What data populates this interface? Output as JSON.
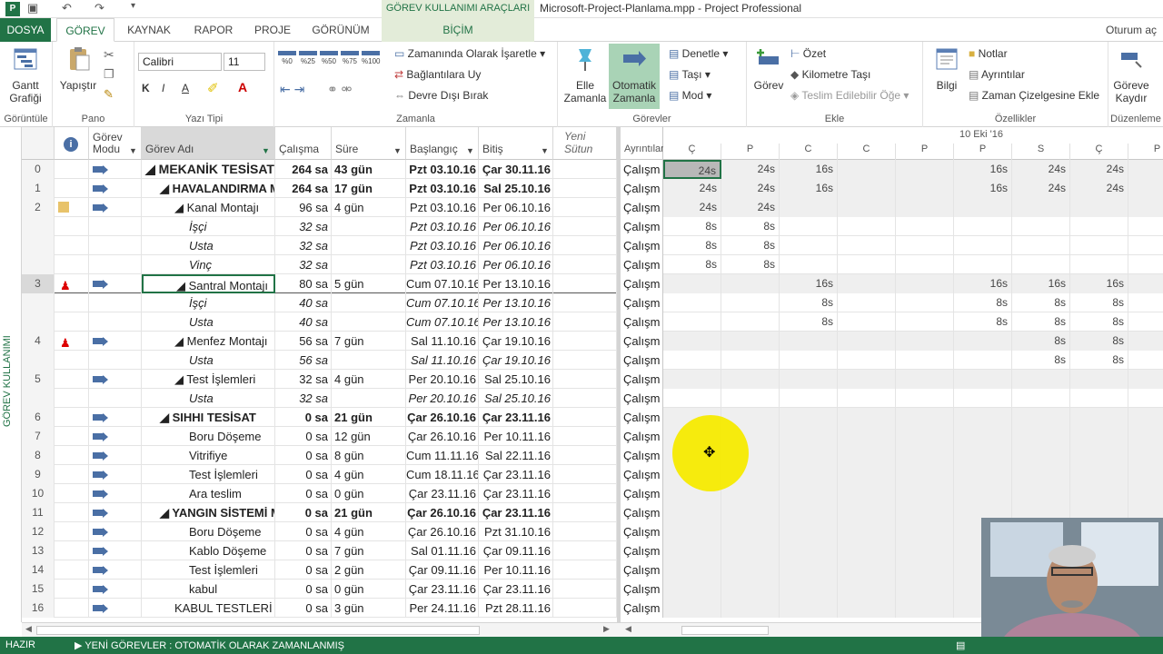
{
  "titlebar": {
    "app_icon": "P",
    "tool_tab": "GÖREV KULLANIMI ARAÇLARI",
    "title": "Microsoft-Project-Planlama.mpp - Project Professional",
    "icons": [
      "save-icon",
      "undo-icon",
      "redo-icon",
      "customize-icon"
    ]
  },
  "tabs": {
    "file": "DOSYA",
    "items": [
      "GÖREV",
      "KAYNAK",
      "RAPOR",
      "PROJE",
      "GÖRÜNÜM"
    ],
    "tool_tab": "BİÇİM",
    "signin": "Oturum aç"
  },
  "ribbon": {
    "view": {
      "gantt": "Gantt\nGrafiği",
      "label": "Görüntüle"
    },
    "clipboard": {
      "paste": "Yapıştır",
      "label": "Pano"
    },
    "font": {
      "name": "Calibri",
      "size": "11",
      "label": "Yazı Tipi"
    },
    "schedule": {
      "percent_buttons": [
        "%0",
        "%25",
        "%50",
        "%75",
        "%100"
      ],
      "mark_on_track": "Zamanında Olarak İşaretle",
      "respect_links": "Bağlantılara Uy",
      "inactivate": "Devre Dışı Bırak",
      "label": "Zamanla"
    },
    "tasks": {
      "manual": "Elle\nZamanla",
      "auto": "Otomatik\nZamanla",
      "inspect": "Denetle",
      "move": "Taşı",
      "mode": "Mod",
      "label": "Görevler"
    },
    "insert": {
      "task": "Görev",
      "summary": "Özet",
      "milestone": "Kilometre Taşı",
      "deliverable": "Teslim Edilebilir Öğe",
      "label": "Ekle"
    },
    "properties": {
      "info": "Bilgi",
      "notes": "Notlar",
      "details": "Ayrıntılar",
      "add_timeline": "Zaman Çizelgesine Ekle",
      "label": "Özellikler"
    },
    "editing": {
      "scroll": "Göreve\nKaydır",
      "label": "Düzenleme"
    }
  },
  "side_label": "GÖREV KULLANIMI",
  "grid": {
    "headers": {
      "mode": "Görev\nModu",
      "name": "Görev Adı",
      "work": "Çalışma",
      "duration": "Süre",
      "start": "Başlangıç",
      "finish": "Bitiş",
      "new_col": "Yeni Sütun"
    },
    "rows": [
      {
        "id": "0",
        "ind": "",
        "mode": true,
        "indent": 0,
        "name": "◢ MEKANİK TESİSAT",
        "work": "264 sa",
        "dur": "43 gün",
        "start": "Pzt 03.10.16",
        "fin": "Çar 30.11.16",
        "bold": true,
        "ital": false,
        "big": true
      },
      {
        "id": "1",
        "ind": "",
        "mode": true,
        "indent": 1,
        "name": "◢ HAVALANDIRMA MONTAJI",
        "work": "264 sa",
        "dur": "17 gün",
        "start": "Pzt 03.10.16",
        "fin": "Sal 25.10.16",
        "bold": true,
        "ital": false
      },
      {
        "id": "2",
        "ind": "note",
        "mode": true,
        "indent": 2,
        "name": "◢ Kanal Montajı",
        "work": "96 sa",
        "dur": "4 gün",
        "start": "Pzt 03.10.16",
        "fin": "Per 06.10.16",
        "bold": false,
        "ital": false
      },
      {
        "id": "",
        "ind": "",
        "mode": false,
        "indent": 3,
        "name": "İşçi",
        "work": "32 sa",
        "dur": "",
        "start": "Pzt 03.10.16",
        "fin": "Per 06.10.16",
        "bold": false,
        "ital": true
      },
      {
        "id": "",
        "ind": "",
        "mode": false,
        "indent": 3,
        "name": "Usta",
        "work": "32 sa",
        "dur": "",
        "start": "Pzt 03.10.16",
        "fin": "Per 06.10.16",
        "bold": false,
        "ital": true
      },
      {
        "id": "",
        "ind": "",
        "mode": false,
        "indent": 3,
        "name": "Vinç",
        "work": "32 sa",
        "dur": "",
        "start": "Pzt 03.10.16",
        "fin": "Per 06.10.16",
        "bold": false,
        "ital": true
      },
      {
        "id": "3",
        "ind": "person",
        "mode": true,
        "indent": 2,
        "name": "◢ Santral Montajı",
        "work": "80 sa",
        "dur": "5 gün",
        "start": "Cum 07.10.16",
        "fin": "Per 13.10.16",
        "bold": false,
        "ital": false,
        "selected": true
      },
      {
        "id": "",
        "ind": "",
        "mode": false,
        "indent": 3,
        "name": "İşçi",
        "work": "40 sa",
        "dur": "",
        "start": "Cum 07.10.16",
        "fin": "Per 13.10.16",
        "bold": false,
        "ital": true
      },
      {
        "id": "",
        "ind": "",
        "mode": false,
        "indent": 3,
        "name": "Usta",
        "work": "40 sa",
        "dur": "",
        "start": "Cum 07.10.16",
        "fin": "Per 13.10.16",
        "bold": false,
        "ital": true
      },
      {
        "id": "4",
        "ind": "person",
        "mode": true,
        "indent": 2,
        "name": "◢ Menfez Montajı",
        "work": "56 sa",
        "dur": "7 gün",
        "start": "Sal 11.10.16",
        "fin": "Çar 19.10.16",
        "bold": false,
        "ital": false
      },
      {
        "id": "",
        "ind": "",
        "mode": false,
        "indent": 3,
        "name": "Usta",
        "work": "56 sa",
        "dur": "",
        "start": "Sal 11.10.16",
        "fin": "Çar 19.10.16",
        "bold": false,
        "ital": true
      },
      {
        "id": "5",
        "ind": "",
        "mode": true,
        "indent": 2,
        "name": "◢ Test İşlemleri",
        "work": "32 sa",
        "dur": "4 gün",
        "start": "Per 20.10.16",
        "fin": "Sal 25.10.16",
        "bold": false,
        "ital": false
      },
      {
        "id": "",
        "ind": "",
        "mode": false,
        "indent": 3,
        "name": "Usta",
        "work": "32 sa",
        "dur": "",
        "start": "Per 20.10.16",
        "fin": "Sal 25.10.16",
        "bold": false,
        "ital": true
      },
      {
        "id": "6",
        "ind": "",
        "mode": true,
        "indent": 1,
        "name": "◢ SIHHI TESİSAT",
        "work": "0 sa",
        "dur": "21 gün",
        "start": "Çar 26.10.16",
        "fin": "Çar 23.11.16",
        "bold": true,
        "ital": false
      },
      {
        "id": "7",
        "ind": "",
        "mode": true,
        "indent": 3,
        "name": "Boru Döşeme",
        "work": "0 sa",
        "dur": "12 gün",
        "start": "Çar 26.10.16",
        "fin": "Per 10.11.16",
        "bold": false,
        "ital": false
      },
      {
        "id": "8",
        "ind": "",
        "mode": true,
        "indent": 3,
        "name": "Vitrifiye",
        "work": "0 sa",
        "dur": "8 gün",
        "start": "Cum 11.11.16",
        "fin": "Sal 22.11.16",
        "bold": false,
        "ital": false
      },
      {
        "id": "9",
        "ind": "",
        "mode": true,
        "indent": 3,
        "name": "Test İşlemleri",
        "work": "0 sa",
        "dur": "4 gün",
        "start": "Cum 18.11.16",
        "fin": "Çar 23.11.16",
        "bold": false,
        "ital": false
      },
      {
        "id": "10",
        "ind": "",
        "mode": true,
        "indent": 3,
        "name": "Ara teslim",
        "work": "0 sa",
        "dur": "0 gün",
        "start": "Çar 23.11.16",
        "fin": "Çar 23.11.16",
        "bold": false,
        "ital": false
      },
      {
        "id": "11",
        "ind": "",
        "mode": true,
        "indent": 1,
        "name": "◢ YANGIN SİSTEMİ MONTAJI",
        "work": "0 sa",
        "dur": "21 gün",
        "start": "Çar 26.10.16",
        "fin": "Çar 23.11.16",
        "bold": true,
        "ital": false
      },
      {
        "id": "12",
        "ind": "",
        "mode": true,
        "indent": 3,
        "name": "Boru Döşeme",
        "work": "0 sa",
        "dur": "4 gün",
        "start": "Çar 26.10.16",
        "fin": "Pzt 31.10.16",
        "bold": false,
        "ital": false
      },
      {
        "id": "13",
        "ind": "",
        "mode": true,
        "indent": 3,
        "name": "Kablo Döşeme",
        "work": "0 sa",
        "dur": "7 gün",
        "start": "Sal 01.11.16",
        "fin": "Çar 09.11.16",
        "bold": false,
        "ital": false
      },
      {
        "id": "14",
        "ind": "",
        "mode": true,
        "indent": 3,
        "name": "Test İşlemleri",
        "work": "0 sa",
        "dur": "2 gün",
        "start": "Çar 09.11.16",
        "fin": "Per 10.11.16",
        "bold": false,
        "ital": false
      },
      {
        "id": "15",
        "ind": "",
        "mode": true,
        "indent": 3,
        "name": "kabul",
        "work": "0 sa",
        "dur": "0 gün",
        "start": "Çar 23.11.16",
        "fin": "Çar 23.11.16",
        "bold": false,
        "ital": false
      },
      {
        "id": "16",
        "ind": "",
        "mode": true,
        "indent": 2,
        "name": "KABUL TESTLERİ",
        "work": "0 sa",
        "dur": "3 gün",
        "start": "Per 24.11.16",
        "fin": "Pzt 28.11.16",
        "bold": false,
        "ital": false
      }
    ]
  },
  "usage": {
    "details_header": "Ayrıntılar",
    "week_label": "10 Eki '16",
    "days": [
      "Ç",
      "P",
      "C",
      "C",
      "P",
      "P",
      "S",
      "Ç",
      "P"
    ],
    "row_label": "Çalışm",
    "values": [
      [
        "24s",
        "24s",
        "16s",
        "",
        "",
        "16s",
        "24s",
        "24s",
        ""
      ],
      [
        "24s",
        "24s",
        "16s",
        "",
        "",
        "16s",
        "24s",
        "24s",
        ""
      ],
      [
        "24s",
        "24s",
        "",
        "",
        "",
        "",
        "",
        "",
        ""
      ],
      [
        "8s",
        "8s",
        "",
        "",
        "",
        "",
        "",
        "",
        ""
      ],
      [
        "8s",
        "8s",
        "",
        "",
        "",
        "",
        "",
        "",
        ""
      ],
      [
        "8s",
        "8s",
        "",
        "",
        "",
        "",
        "",
        "",
        ""
      ],
      [
        "",
        "",
        "16s",
        "",
        "",
        "16s",
        "16s",
        "16s",
        ""
      ],
      [
        "",
        "",
        "8s",
        "",
        "",
        "8s",
        "8s",
        "8s",
        ""
      ],
      [
        "",
        "",
        "8s",
        "",
        "",
        "8s",
        "8s",
        "8s",
        ""
      ],
      [
        "",
        "",
        "",
        "",
        "",
        "",
        "8s",
        "8s",
        ""
      ],
      [
        "",
        "",
        "",
        "",
        "",
        "",
        "8s",
        "8s",
        ""
      ],
      [
        "",
        "",
        "",
        "",
        "",
        "",
        "",
        "",
        ""
      ],
      [
        "",
        "",
        "",
        "",
        "",
        "",
        "",
        "",
        ""
      ],
      [
        "",
        "",
        "",
        "",
        "",
        "",
        "",
        "",
        ""
      ],
      [
        "",
        "",
        "",
        "",
        "",
        "",
        "",
        "",
        ""
      ],
      [
        "",
        "",
        "",
        "",
        "",
        "",
        "",
        "",
        ""
      ],
      [
        "",
        "",
        "",
        "",
        "",
        "",
        "",
        "",
        ""
      ],
      [
        "",
        "",
        "",
        "",
        "",
        "",
        "",
        "",
        ""
      ],
      [
        "",
        "",
        "",
        "",
        "",
        "",
        "",
        "",
        ""
      ],
      [
        "",
        "",
        "",
        "",
        "",
        "",
        "",
        "",
        ""
      ],
      [
        "",
        "",
        "",
        "",
        "",
        "",
        "",
        "",
        ""
      ],
      [
        "",
        "",
        "",
        "",
        "",
        "",
        "",
        "",
        ""
      ],
      [
        "",
        "",
        "",
        "",
        "",
        "",
        "",
        "",
        ""
      ],
      [
        "",
        "",
        "",
        "",
        "",
        "",
        "",
        "",
        ""
      ]
    ]
  },
  "status": {
    "ready": "HAZIR",
    "new_tasks": "YENİ GÖREVLER : OTOMATİK OLARAK ZAMANLANMIŞ"
  }
}
